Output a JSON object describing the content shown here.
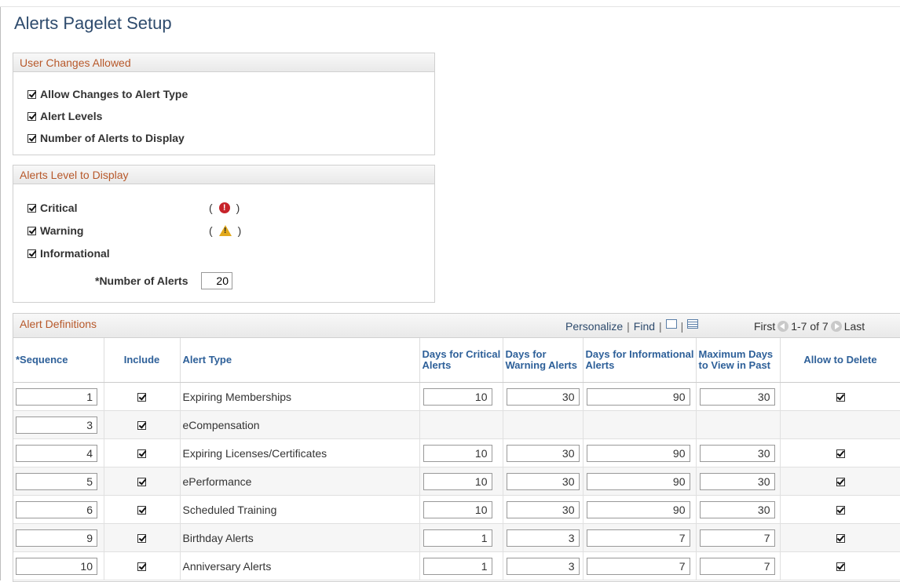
{
  "page": {
    "title": "Alerts Pagelet Setup"
  },
  "user_changes": {
    "header": "User Changes Allowed",
    "items": [
      {
        "label": "Allow Changes to Alert Type",
        "checked": true
      },
      {
        "label": "Alert Levels",
        "checked": true
      },
      {
        "label": "Number of Alerts to Display",
        "checked": true
      }
    ]
  },
  "levels": {
    "header": "Alerts Level to Display",
    "items": [
      {
        "label": "Critical",
        "checked": true,
        "icon": "critical-icon",
        "open": "(",
        "close": ")",
        "glyph": "!"
      },
      {
        "label": "Warning",
        "checked": true,
        "icon": "warning-icon",
        "open": "(",
        "close": ")",
        "glyph": "!"
      },
      {
        "label": "Informational",
        "checked": true
      }
    ],
    "number_label": "*Number of Alerts",
    "number_value": "20"
  },
  "grid": {
    "title": "Alert Definitions",
    "tools": {
      "personalize": "Personalize",
      "sep": "|",
      "find": "Find"
    },
    "nav": {
      "first": "First",
      "range": "1-7 of 7",
      "last": "Last"
    },
    "columns": {
      "sequence": "*Sequence",
      "include": "Include",
      "alert_type": "Alert Type",
      "critical": "Days for Critical Alerts",
      "warning": "Days for Warning Alerts",
      "info": "Days for Informational Alerts",
      "max_days": "Maximum Days to View in Past",
      "allow_delete": "Allow to Delete"
    },
    "rows": [
      {
        "seq": "1",
        "include": true,
        "type": "Expiring Memberships",
        "critical": "10",
        "warning": "30",
        "info": "90",
        "max": "30",
        "allow_delete": true
      },
      {
        "seq": "3",
        "include": true,
        "type": "eCompensation",
        "critical": "",
        "warning": "",
        "info": "",
        "max": "",
        "allow_delete": false
      },
      {
        "seq": "4",
        "include": true,
        "type": "Expiring Licenses/Certificates",
        "critical": "10",
        "warning": "30",
        "info": "90",
        "max": "30",
        "allow_delete": true
      },
      {
        "seq": "5",
        "include": true,
        "type": "ePerformance",
        "critical": "10",
        "warning": "30",
        "info": "90",
        "max": "30",
        "allow_delete": true
      },
      {
        "seq": "6",
        "include": true,
        "type": "Scheduled Training",
        "critical": "10",
        "warning": "30",
        "info": "90",
        "max": "30",
        "allow_delete": true
      },
      {
        "seq": "9",
        "include": true,
        "type": "Birthday Alerts",
        "critical": "1",
        "warning": "3",
        "info": "7",
        "max": "7",
        "allow_delete": true
      },
      {
        "seq": "10",
        "include": true,
        "type": "Anniversary Alerts",
        "critical": "1",
        "warning": "3",
        "info": "7",
        "max": "7",
        "allow_delete": true
      }
    ]
  },
  "colors": {
    "accent": "#b7582a",
    "link": "#2e6099",
    "title": "#2e4b6d",
    "critical": "#c7232a",
    "warning": "#e2a91c"
  }
}
